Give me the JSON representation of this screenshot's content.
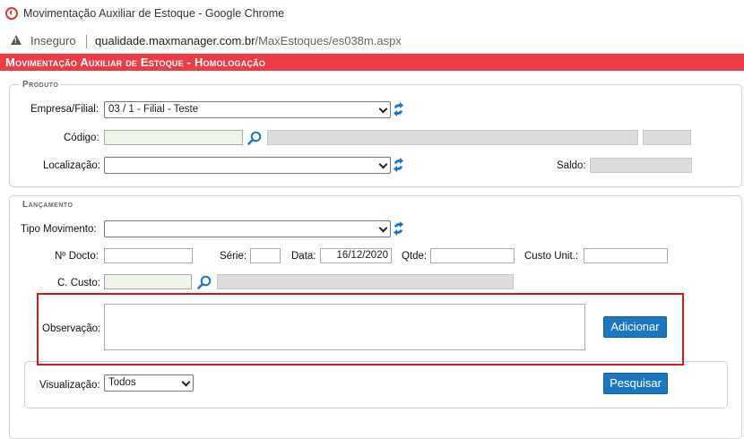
{
  "window": {
    "title": "Movimentação Auxiliar de Estoque - Google Chrome"
  },
  "addressbar": {
    "security_label": "Inseguro",
    "url_host": "qualidade.maxmanager.com.br",
    "url_path": "/MaxEstoques/es038m.aspx"
  },
  "page": {
    "title": "Movimentação Auxiliar de Estoque  - Homologação"
  },
  "produto": {
    "legend": "Produto",
    "empresa_label": "Empresa/Filial:",
    "empresa_value": "03 / 1 - Filial - Teste",
    "codigo_label": "Código:",
    "localizacao_label": "Localização:",
    "localizacao_value": "",
    "saldo_label": "Saldo:"
  },
  "lancamento": {
    "legend": "Lançamento",
    "tipo_label": "Tipo Movimento:",
    "tipo_value": "",
    "ndocto_label": "Nº Docto:",
    "serie_label": "Série:",
    "data_label": "Data:",
    "data_value": "16/12/2020",
    "qtde_label": "Qtde:",
    "custo_unit_label": "Custo Unit.:",
    "ccusto_label": "C. Custo:",
    "observacao_label": "Observação:",
    "adicionar_label": "Adicionar"
  },
  "visualizacao": {
    "label": "Visualização:",
    "value": "Todos",
    "pesquisar_label": "Pesquisar"
  },
  "icons": {
    "refresh": "refresh-icon",
    "search": "search-icon",
    "warning": "warning-icon",
    "chevron": "chevron-down-icon"
  },
  "colors": {
    "header_red": "#ef3d47",
    "button_blue": "#1a78c2",
    "highlight_red": "#e0161e"
  }
}
